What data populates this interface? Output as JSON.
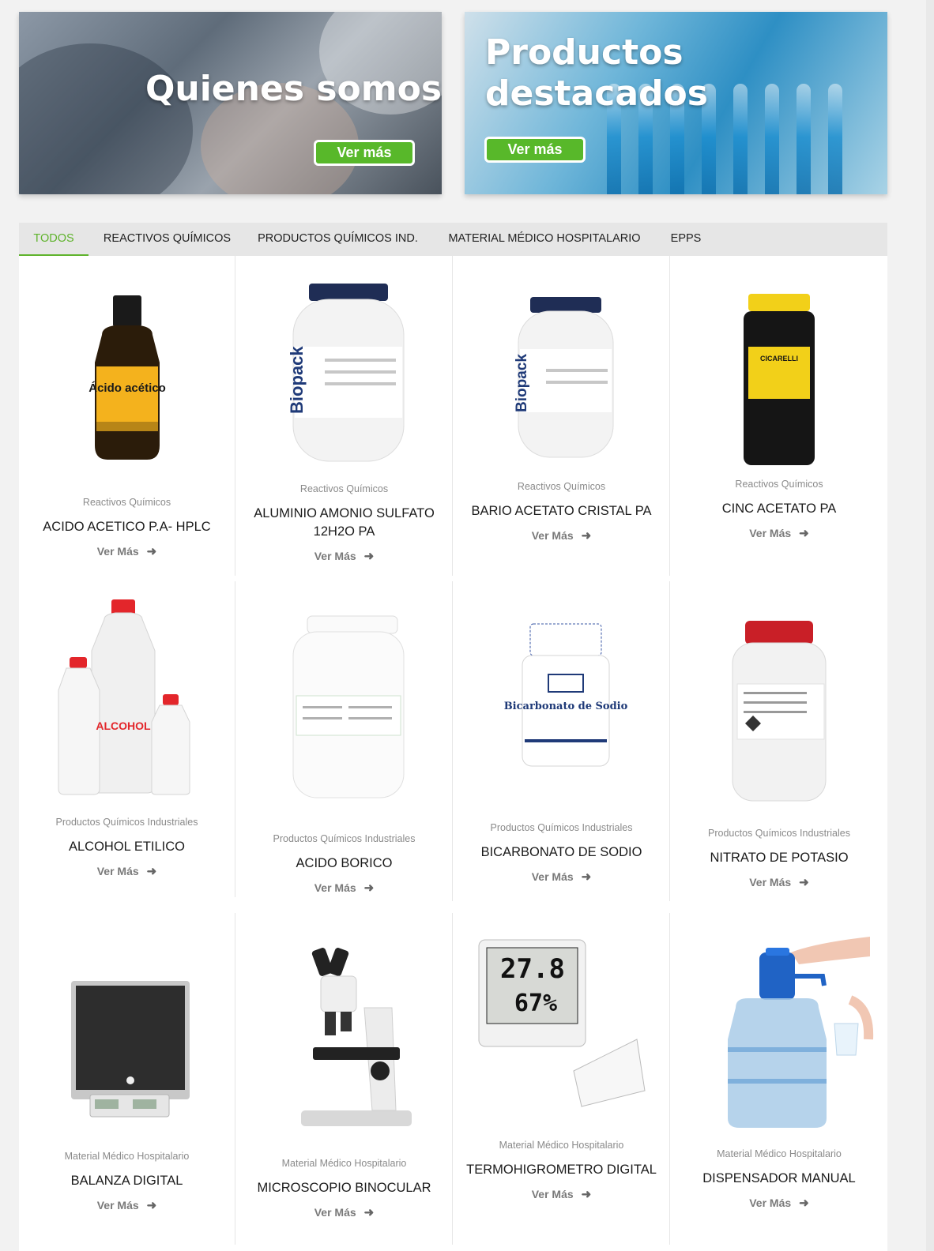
{
  "banners": [
    {
      "title": "Quienes somos",
      "button": "Ver más"
    },
    {
      "title": "Productos destacados",
      "button": "Ver más"
    }
  ],
  "tabs": [
    {
      "label": "TODOS"
    },
    {
      "label": "REACTIVOS QUÍMICOS"
    },
    {
      "label": "PRODUCTOS QUÍMICOS IND."
    },
    {
      "label": "MATERIAL MÉDICO HOSPITALARIO"
    },
    {
      "label": "EPPS"
    }
  ],
  "products": [
    {
      "category": "Reactivos Químicos",
      "name": "ACIDO ACETICO P.A- HPLC",
      "link": "Ver Más",
      "image": "amber-bottle",
      "label": "Ácido acético"
    },
    {
      "category": "Reactivos Químicos",
      "name": "ALUMINIO AMONIO SULFATO 12H2O PA",
      "link": "Ver Más",
      "image": "biopack-jar",
      "label": "Biopack"
    },
    {
      "category": "Reactivos Químicos",
      "name": "BARIO ACETATO CRISTAL PA",
      "link": "Ver Más",
      "image": "biopack-jar",
      "label": "Biopack"
    },
    {
      "category": "Reactivos Químicos",
      "name": "CINC ACETATO PA",
      "link": "Ver Más",
      "image": "black-jar",
      "label": "CICARELLI"
    },
    {
      "category": "Productos Químicos Industriales",
      "name": "ALCOHOL ETILICO",
      "link": "Ver Más",
      "image": "alcohol-bottles",
      "label": "ALCOHOL"
    },
    {
      "category": "Productos Químicos Industriales",
      "name": "ACIDO BORICO",
      "link": "Ver Más",
      "image": "white-jar",
      "label": ""
    },
    {
      "category": "Productos Químicos Industriales",
      "name": "BICARBONATO DE SODIO",
      "link": "Ver Más",
      "image": "bicarbonate-jar",
      "label": "Bicarbonato de Sodio"
    },
    {
      "category": "Productos Químicos Industriales",
      "name": "NITRATO DE POTASIO",
      "link": "Ver Más",
      "image": "red-cap-jar",
      "label": ""
    },
    {
      "category": "Material Médico Hospitalario",
      "name": "BALANZA DIGITAL",
      "link": "Ver Más",
      "image": "scale",
      "label": ""
    },
    {
      "category": "Material Médico Hospitalario",
      "name": "MICROSCOPIO BINOCULAR",
      "link": "Ver Más",
      "image": "microscope",
      "label": ""
    },
    {
      "category": "Material Médico Hospitalario",
      "name": "TERMOHIGROMETRO DIGITAL",
      "link": "Ver Más",
      "image": "thermohygrometer",
      "label": "27.8"
    },
    {
      "category": "Material Médico Hospitalario",
      "name": "DISPENSADOR MANUAL",
      "link": "Ver Más",
      "image": "water-dispenser",
      "label": ""
    }
  ],
  "colors": {
    "accent": "#5fb32c",
    "button": "#58b82a"
  }
}
